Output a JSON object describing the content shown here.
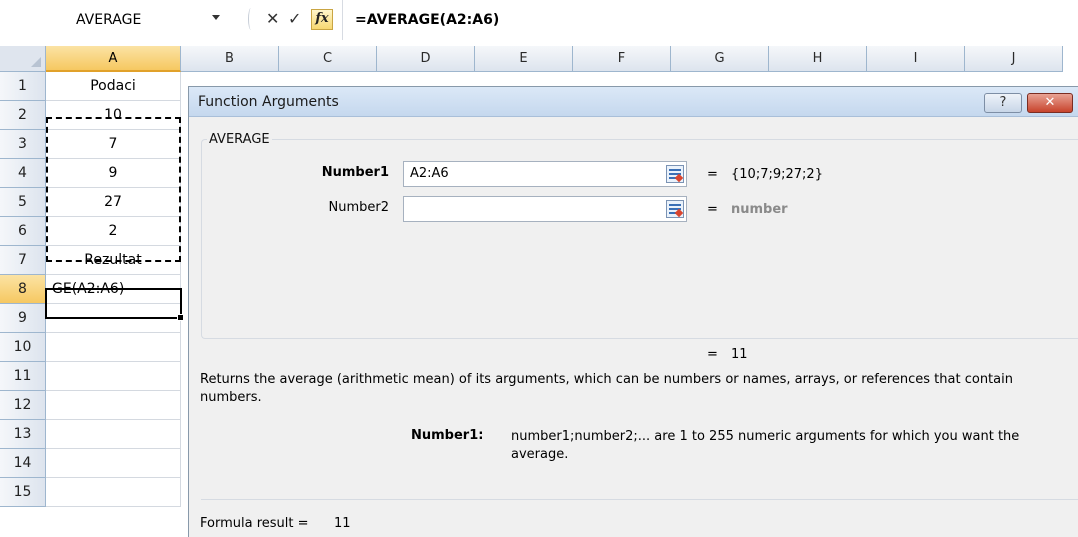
{
  "formula_bar": {
    "name_box": "AVERAGE",
    "cancel_glyph": "✕",
    "enter_glyph": "✓",
    "fx_glyph": "fx",
    "formula": "=AVERAGE(A2:A6)"
  },
  "grid": {
    "columns": [
      "A",
      "B",
      "C",
      "D",
      "E",
      "F",
      "G",
      "H",
      "I",
      "J"
    ],
    "rows": [
      "1",
      "2",
      "3",
      "4",
      "5",
      "6",
      "7",
      "8",
      "9",
      "10",
      "11",
      "12",
      "13",
      "14",
      "15"
    ],
    "column_a": [
      "Podaci",
      "10",
      "7",
      "9",
      "27",
      "2",
      "Rezultat",
      "GE(A2:A6)",
      "",
      "",
      "",
      "",
      "",
      "",
      ""
    ]
  },
  "dialog": {
    "title": "Function Arguments",
    "help_glyph": "?",
    "close_glyph": "✕",
    "function_name": "AVERAGE",
    "arg1_label": "Number1",
    "arg1_value": "A2:A6",
    "arg1_result": "{10;7;9;27;2}",
    "arg2_label": "Number2",
    "arg2_value": "",
    "arg2_result": "number",
    "equals": "=",
    "result": "11",
    "description": "Returns the average (arithmetic mean) of its arguments, which can be numbers or names, arrays, or references that contain numbers.",
    "arg_help_name": "Number1:",
    "arg_help_text": "number1;number2;... are 1 to 255 numeric arguments for which you want the average.",
    "formula_result_label": "Formula result =",
    "formula_result_value": "11"
  },
  "colors": {
    "selection_header": "#f6c861",
    "dialog_title_bg": "#c5d8ee",
    "close_button": "#c7432c"
  }
}
